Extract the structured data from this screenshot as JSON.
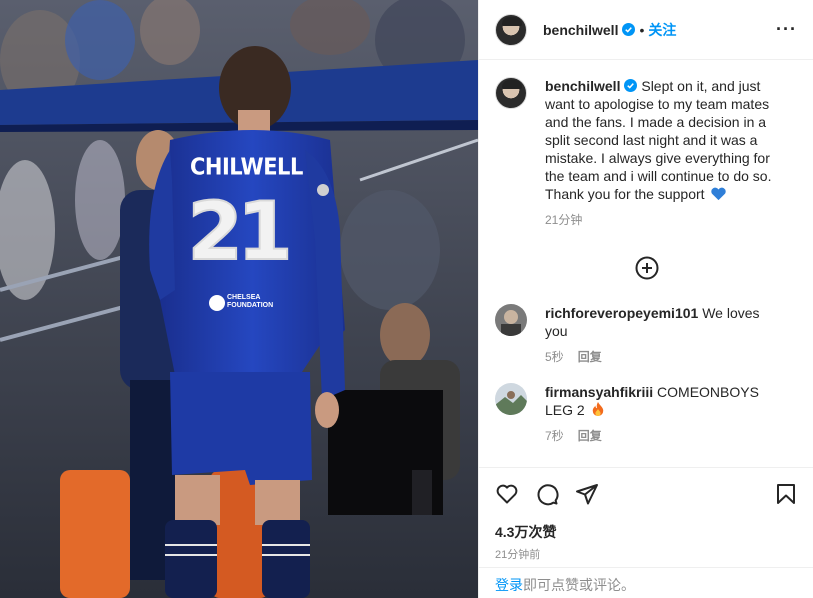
{
  "post": {
    "jersey_name": "CHILWELL",
    "jersey_number": "21",
    "sponsor_line1": "CHELSEA",
    "sponsor_line2": "FOUNDATION"
  },
  "header": {
    "username": "benchilwell",
    "separator": "•",
    "follow_label": "关注",
    "more_icon": "more-horizontal-icon",
    "more_label": "···"
  },
  "caption": {
    "username": "benchilwell",
    "text": "Slept on it, and just want to apologise to my team mates and the fans. I made a decision in a split second last night and it was a mistake. I always give everything for the team and i will continue to do so. Thank you for the support",
    "emoji": "blue-heart-icon",
    "time": "21分钟"
  },
  "load_more_icon": "plus-circle-icon",
  "comments": [
    {
      "username": "richforeveropeyemi101",
      "text": "We loves you",
      "time": "5秒",
      "reply_label": "回复"
    },
    {
      "username": "firmansyahfikriii",
      "text": "COMEONBOYS LEG 2",
      "emoji": "fire-icon",
      "time": "7秒",
      "reply_label": "回复"
    }
  ],
  "actions": {
    "like_icon": "heart-icon",
    "comment_icon": "comment-icon",
    "share_icon": "send-icon",
    "save_icon": "bookmark-icon"
  },
  "likes": "4.3万次赞",
  "posted_ago": "21分钟前",
  "login_prompt": {
    "link": "登录",
    "rest": "即可点赞或评论。"
  },
  "colors": {
    "accent": "#0095f6",
    "jersey_blue": "#1f3fa8",
    "verified": "#0095f6"
  }
}
